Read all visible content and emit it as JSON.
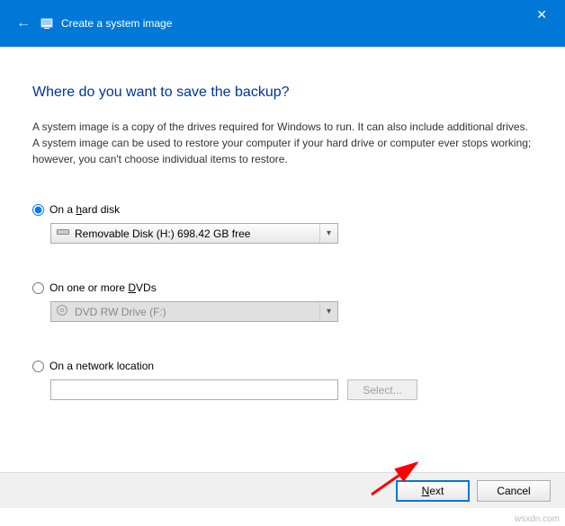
{
  "titlebar": {
    "title": "Create a system image"
  },
  "heading": "Where do you want to save the backup?",
  "description": "A system image is a copy of the drives required for Windows to run. It can also include additional drives. A system image can be used to restore your computer if your hard drive or computer ever stops working; however, you can't choose individual items to restore.",
  "options": {
    "harddisk": {
      "label_pre": "On a ",
      "label_key": "h",
      "label_post": "ard disk",
      "selected": "Removable Disk (H:)  698.42 GB free"
    },
    "dvd": {
      "label_pre": "On one or more ",
      "label_key": "D",
      "label_post": "VDs",
      "selected": "DVD RW Drive (F:)"
    },
    "network": {
      "label": "On a network location",
      "select_button": "Select..."
    }
  },
  "buttons": {
    "next_key": "N",
    "next_rest": "ext",
    "cancel": "Cancel"
  },
  "watermark": "wsxdn.com"
}
